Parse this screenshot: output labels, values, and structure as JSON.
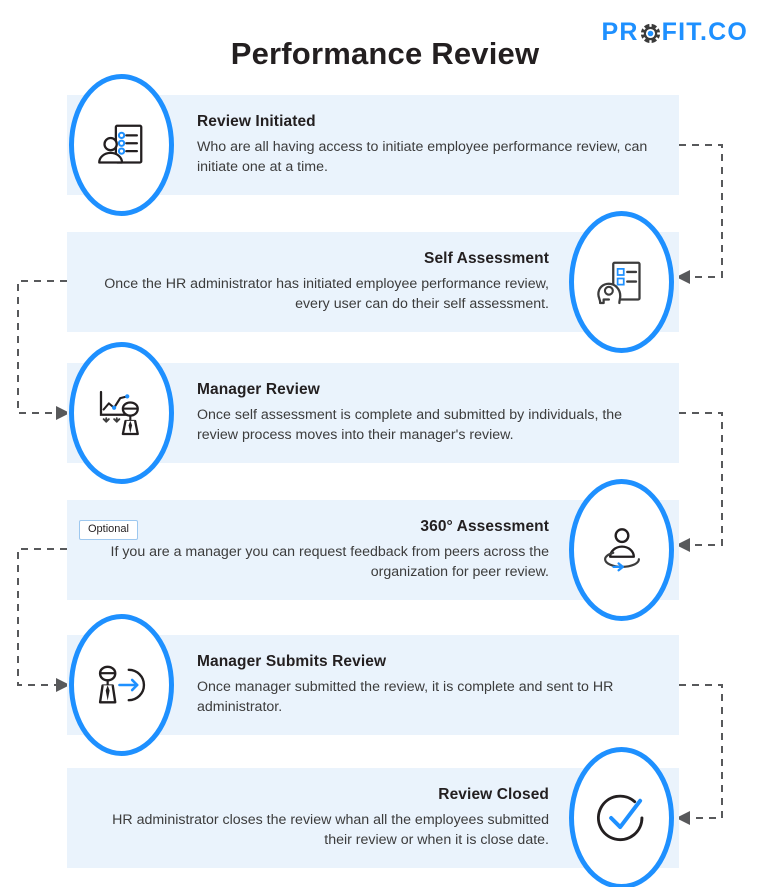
{
  "header": {
    "title": "Performance Review",
    "logo": {
      "text_before": "PR",
      "gear_letter": "O",
      "text_after": "FIT.CO",
      "full_text": "PROFIT.CO",
      "color": "#1e90ff",
      "gear_color": "#3b3b3b"
    }
  },
  "theme": {
    "page_background": "#ffffff",
    "card_background": "#eaf3fc",
    "accent": "#1e90ff",
    "title_color": "#231f20",
    "body_text_color": "#3c3c3c",
    "connector_color": "#58595b",
    "badge_border": "#9ec8ef"
  },
  "steps": [
    {
      "index": 1,
      "title": "Review Initiated",
      "description": "Who are all having access to initiate employee performance review, can initiate one at a time.",
      "icon": "person-checklist-icon",
      "side": "left",
      "badge": null
    },
    {
      "index": 2,
      "title": "Self Assessment",
      "description": "Once the HR administrator has initiated employee performance review, every user can do their self assessment.",
      "icon": "head-checklist-icon",
      "side": "right",
      "badge": null
    },
    {
      "index": 3,
      "title": "Manager Review",
      "description": "Once self assessment is complete and submitted by individuals, the review process moves into their manager's review.",
      "icon": "chart-manager-icon",
      "side": "left",
      "badge": null
    },
    {
      "index": 4,
      "title": "360° Assessment",
      "description": "If you are a manager you can request feedback from peers across the organization for peer review.",
      "icon": "person-circular-arrow-icon",
      "side": "right",
      "badge": "Optional"
    },
    {
      "index": 5,
      "title": "Manager Submits Review",
      "description": "Once manager submitted the review, it is complete and sent to HR administrator.",
      "icon": "manager-submit-arrow-icon",
      "side": "left",
      "badge": null
    },
    {
      "index": 6,
      "title": "Review Closed",
      "description": "HR administrator closes the review whan all the employees submitted their review or when it is close date.",
      "icon": "check-circle-icon",
      "side": "right",
      "badge": null
    }
  ],
  "connectors": [
    {
      "from_step": 1,
      "to_step": 2,
      "direction": "right-down-left"
    },
    {
      "from_step": 2,
      "to_step": 3,
      "direction": "left-down-right"
    },
    {
      "from_step": 3,
      "to_step": 4,
      "direction": "right-down-left"
    },
    {
      "from_step": 4,
      "to_step": 5,
      "direction": "left-down-right"
    },
    {
      "from_step": 5,
      "to_step": 6,
      "direction": "right-down-left"
    }
  ]
}
